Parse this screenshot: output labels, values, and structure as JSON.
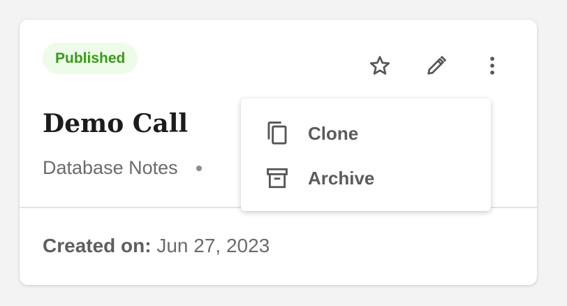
{
  "card": {
    "status_badge": "Published",
    "title": "Demo Call",
    "subtitle_source": "Database Notes",
    "created_label": "Created on:",
    "created_value": "Jun 27, 2023"
  },
  "actions": {
    "favorite_icon": "star-outline-icon",
    "edit_icon": "pencil-icon",
    "more_icon": "more-vertical-icon"
  },
  "dropdown_menu": {
    "items": [
      {
        "label": "Clone",
        "icon": "copy-icon"
      },
      {
        "label": "Archive",
        "icon": "archive-icon"
      }
    ]
  },
  "colors": {
    "badge_bg": "#eefbe9",
    "badge_text": "#3a9a1a",
    "icon": "#555555",
    "text_primary": "#1c1c1c",
    "text_secondary": "#6b6b6b"
  }
}
